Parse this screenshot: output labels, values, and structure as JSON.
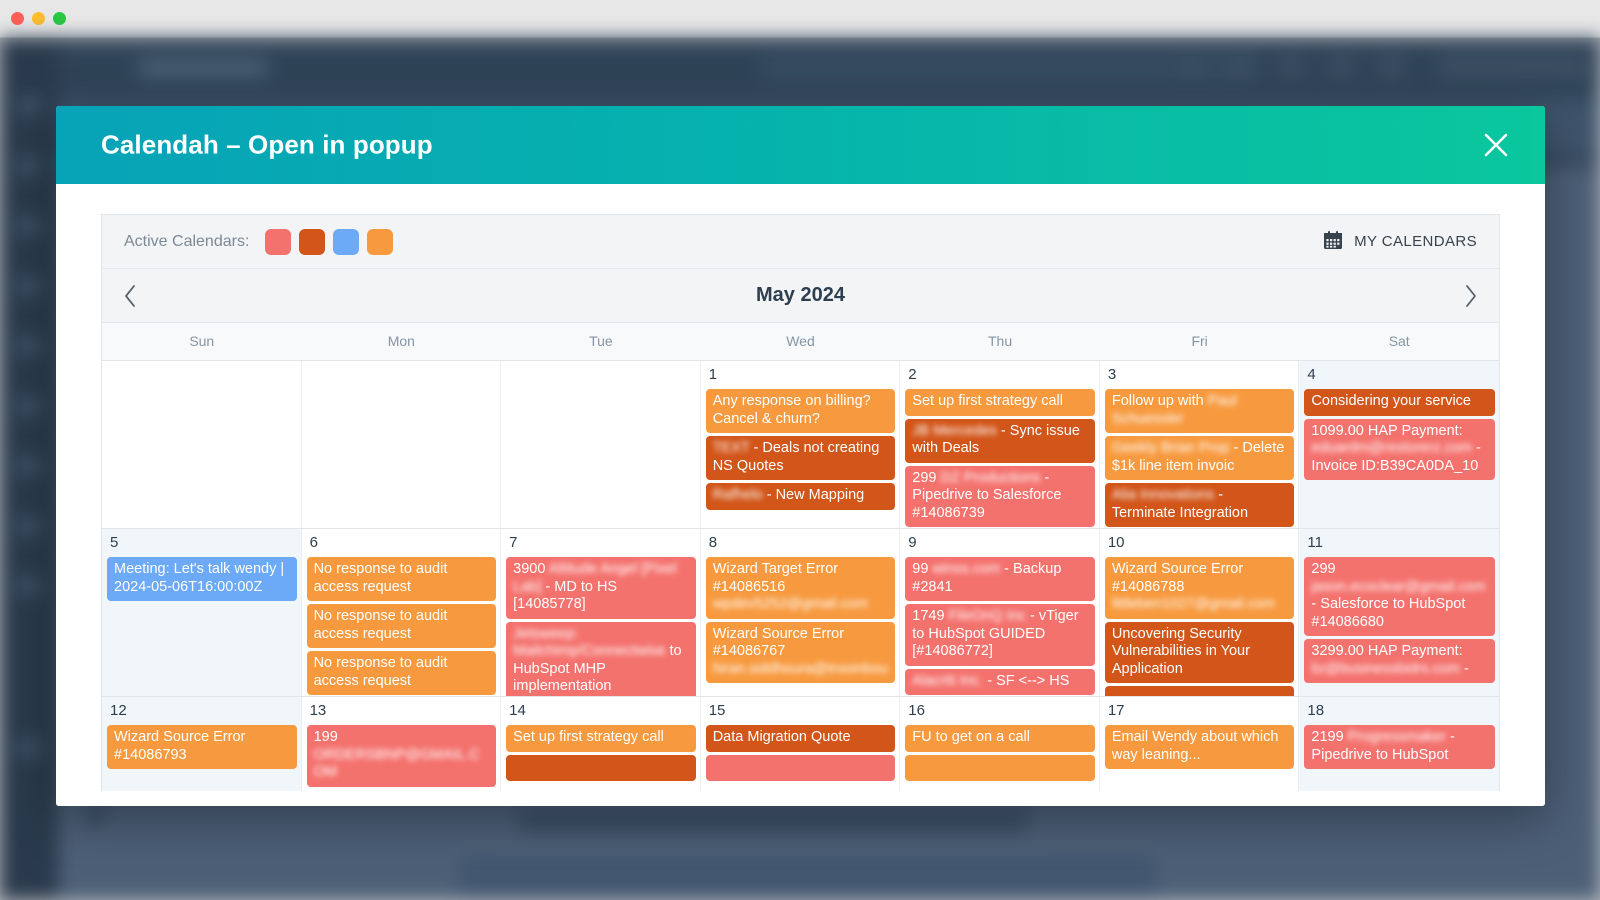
{
  "window": {
    "traffic_lights": [
      "close",
      "minimize",
      "maximize"
    ]
  },
  "modal": {
    "title": "Calendah – Open in popup",
    "close_label": "×"
  },
  "toolbar": {
    "active_calendars_label": "Active Calendars:",
    "swatches": [
      {
        "name": "calendar-color-salmon",
        "color": "#f4726e"
      },
      {
        "name": "calendar-color-dark-orange",
        "color": "#d2551a"
      },
      {
        "name": "calendar-color-blue",
        "color": "#6ca9f7"
      },
      {
        "name": "calendar-color-orange",
        "color": "#f79a3f"
      }
    ],
    "my_calendars_label": "MY CALENDARS"
  },
  "calendar": {
    "month_label": "May 2024",
    "prev_label": "‹",
    "next_label": "›",
    "weekdays": [
      "Sun",
      "Mon",
      "Tue",
      "Wed",
      "Thu",
      "Fri",
      "Sat"
    ],
    "colors": {
      "salmon": "#f4726e",
      "dark_orange": "#d2551a",
      "blue": "#6ca9f7",
      "orange": "#f79a3f"
    },
    "weeks": [
      {
        "days": [
          {
            "num": "",
            "weekend": true,
            "blank": true,
            "events": []
          },
          {
            "num": "",
            "weekend": false,
            "blank": true,
            "events": []
          },
          {
            "num": "",
            "weekend": false,
            "blank": true,
            "events": []
          },
          {
            "num": "1",
            "weekend": false,
            "events": [
              {
                "text": "Any response on billing? Cancel & churn?",
                "color": "#f79a3f",
                "blurred": false
              },
              {
                "text": "TEXT - Deals not creating NS Quotes",
                "color": "#d2551a",
                "blurred": false,
                "redacted_prefix": "TEXT"
              },
              {
                "text": "Rafhelo - New Mapping",
                "color": "#d2551a",
                "blurred": false,
                "redacted_prefix": "Rafhelo"
              }
            ]
          },
          {
            "num": "2",
            "weekend": false,
            "events": [
              {
                "text": "Set up first strategy call",
                "color": "#f79a3f",
                "blurred": false
              },
              {
                "text": "JB Mercedes - Sync issue with Deals",
                "color": "#d2551a",
                "blurred": false,
                "redacted_prefix": "JB Mercedes"
              },
              {
                "text": "299 DZ Productions - Pipedrive to Salesforce #14086739",
                "color": "#f4726e",
                "blurred": false,
                "redacted_prefix": "DZ Productions"
              }
            ]
          },
          {
            "num": "3",
            "weekend": false,
            "events": [
              {
                "text": "Follow up with Paul Schuessler",
                "color": "#f79a3f",
                "blurred": false,
                "redacted_prefix": "Paul Schuessler"
              },
              {
                "text": "Geekly Brian Prop - Delete $1k line item invoic",
                "color": "#f79a3f",
                "blurred": false,
                "redacted_prefix": "Geekly Brian Prop"
              },
              {
                "text": "Alia Innovations - Terminate Integration",
                "color": "#d2551a",
                "blurred": false,
                "redacted_prefix": "Alia Innovations"
              }
            ]
          },
          {
            "num": "4",
            "weekend": true,
            "events": [
              {
                "text": "Considering your service",
                "color": "#d2551a",
                "blurred": false
              },
              {
                "text": "1099.00 HAP Payment: eduardm@restorerz.com - Invoice ID:B39CA0DA_10",
                "color": "#f4726e",
                "blurred": false,
                "redacted_prefix": "eduardm@restorerz.com"
              }
            ]
          }
        ]
      },
      {
        "days": [
          {
            "num": "5",
            "weekend": true,
            "events": [
              {
                "text": "Meeting: Let's talk wendy | 2024-05-06T16:00:00Z",
                "color": "#6ca9f7",
                "blurred": false
              }
            ]
          },
          {
            "num": "6",
            "weekend": false,
            "events": [
              {
                "text": "No response to audit access request",
                "color": "#f79a3f",
                "blurred": false
              },
              {
                "text": "No response to audit access request",
                "color": "#f79a3f",
                "blurred": false
              },
              {
                "text": "No response to audit access request",
                "color": "#f79a3f",
                "blurred": false
              }
            ]
          },
          {
            "num": "7",
            "weekend": false,
            "events": [
              {
                "text": "3900 Altitude Angel [Pixel Lab] - MD to HS [14085778]",
                "color": "#f4726e",
                "blurred": false,
                "redacted_prefix": "Altitude Angel [Pixel Lab]"
              },
              {
                "text": "Jetsweep: Mailchimp/Connectwise to HubSpot MHP implementation",
                "color": "#f4726e",
                "blurred": false,
                "redacted_prefix": "Jetsweep: Mailchimp/Connectwise"
              }
            ]
          },
          {
            "num": "8",
            "weekend": false,
            "events": [
              {
                "text": "Wizard Target Error #14086516 wpdev5252@gmail.com",
                "color": "#f79a3f",
                "blurred": false,
                "redacted_prefix": "wpdev5252@gmail.com"
              },
              {
                "text": "Wizard Source Error #14086767 hiran.siddhoura@trooinbou",
                "color": "#f79a3f",
                "blurred": false,
                "redacted_prefix": "hiran.siddhoura@trooinbou"
              }
            ]
          },
          {
            "num": "9",
            "weekend": false,
            "events": [
              {
                "text": "99 winss.com - Backup #2841",
                "color": "#f4726e",
                "blurred": false,
                "redacted_prefix": "winss.com"
              },
              {
                "text": "1749 FileOnQ Inc - vTiger to HubSpot GUIDED [#14086772]",
                "color": "#f4726e",
                "blurred": false,
                "redacted_prefix": "FileOnQ Inc"
              },
              {
                "text": "Alacriti Inc. - SF <--> HS",
                "color": "#f4726e",
                "blurred": false,
                "redacted_prefix": "Alacriti Inc."
              }
            ]
          },
          {
            "num": "10",
            "weekend": false,
            "events": [
              {
                "text": "Wizard Source Error #14086788 littleben1027@gmail.com",
                "color": "#f79a3f",
                "blurred": false,
                "redacted_prefix": "littleben1027@gmail.com"
              },
              {
                "text": "Uncovering Security Vulnerabilities in Your Application",
                "color": "#d2551a",
                "blurred": false
              },
              {
                "text": "",
                "color": "#d2551a",
                "blurred": false
              }
            ]
          },
          {
            "num": "11",
            "weekend": true,
            "events": [
              {
                "text": "299 jason.ecoclear@gmail.com - Salesforce to HubSpot #14086680",
                "color": "#f4726e",
                "blurred": false,
                "redacted_prefix": "jason.ecoclear@gmail.com"
              },
              {
                "text": "3299.00 HAP Payment: liz@businessbidrs.com -",
                "color": "#f4726e",
                "blurred": false,
                "redacted_prefix": "liz@businessbidrs.com"
              }
            ]
          }
        ]
      },
      {
        "days": [
          {
            "num": "12",
            "weekend": true,
            "events": [
              {
                "text": "Wizard Source Error #14086793",
                "color": "#f79a3f",
                "blurred": false
              }
            ]
          },
          {
            "num": "13",
            "weekend": false,
            "events": [
              {
                "text": "199 ORDERSBNP@GMAIL.COM",
                "color": "#f4726e",
                "blurred": false,
                "redacted_prefix": "ORDERSBNP@GMAIL.COM"
              }
            ]
          },
          {
            "num": "14",
            "weekend": false,
            "events": [
              {
                "text": "Set up first strategy call",
                "color": "#f79a3f",
                "blurred": false
              },
              {
                "text": "",
                "color": "#d2551a",
                "blurred": false
              }
            ]
          },
          {
            "num": "15",
            "weekend": false,
            "events": [
              {
                "text": "Data Migration Quote",
                "color": "#d2551a",
                "blurred": false
              },
              {
                "text": "",
                "color": "#f4726e",
                "blurred": false
              }
            ]
          },
          {
            "num": "16",
            "weekend": false,
            "events": [
              {
                "text": "FU to get on a call",
                "color": "#f79a3f",
                "blurred": false
              },
              {
                "text": "",
                "color": "#f79a3f",
                "blurred": false
              }
            ]
          },
          {
            "num": "17",
            "weekend": false,
            "events": [
              {
                "text": "Email Wendy about which way leaning...",
                "color": "#f79a3f",
                "blurred": false
              }
            ]
          },
          {
            "num": "18",
            "weekend": true,
            "events": [
              {
                "text": "2199 Progressmaker - Pipedrive to HubSpot",
                "color": "#f4726e",
                "blurred": false,
                "redacted_prefix": "Progressmaker"
              }
            ]
          }
        ]
      }
    ]
  }
}
